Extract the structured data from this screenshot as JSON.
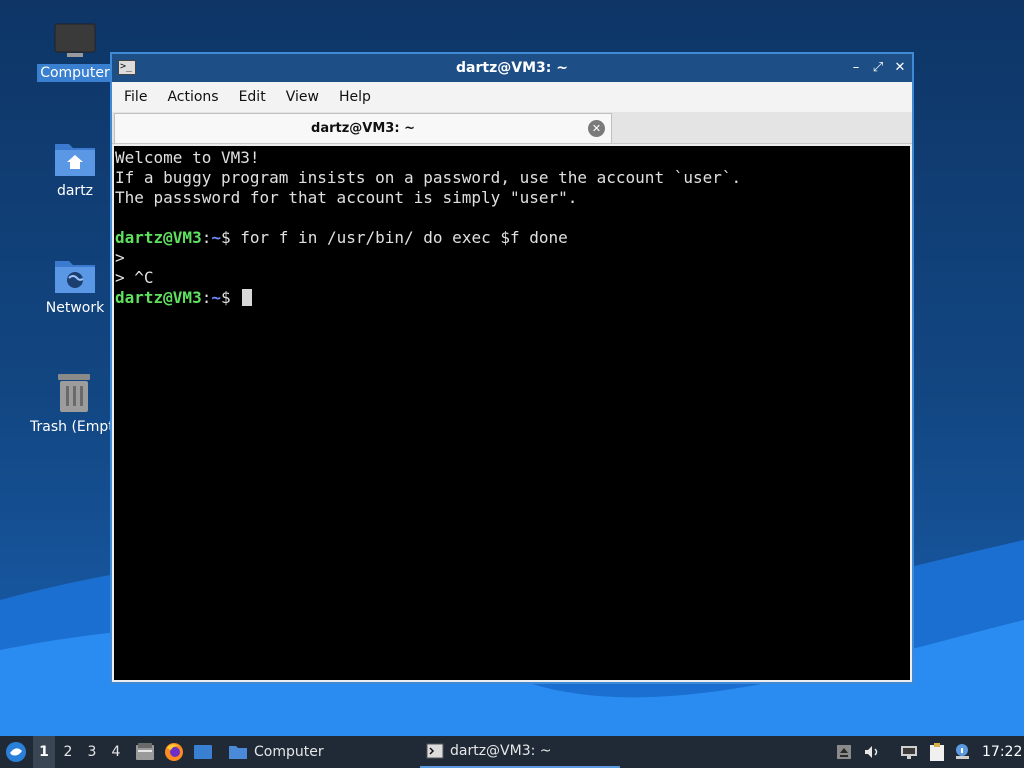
{
  "desktop": {
    "icons": [
      {
        "label": "Computer",
        "icon": "computer-icon"
      },
      {
        "label": "dartz",
        "icon": "home-folder-icon"
      },
      {
        "label": "Network",
        "icon": "network-folder-icon"
      },
      {
        "label": "Trash (Empty)",
        "icon": "trash-icon"
      }
    ]
  },
  "window": {
    "title": "dartz@VM3: ~",
    "menu": [
      "File",
      "Actions",
      "Edit",
      "View",
      "Help"
    ],
    "tab_label": "dartz@VM3: ~"
  },
  "terminal": {
    "lines": [
      "Welcome to VM3!",
      "If a buggy program insists on a password, use the account `user`.",
      "The passsword for that account is simply \"user\"."
    ],
    "prompt_user": "dartz@VM3",
    "prompt_sep": ":",
    "prompt_path": "~",
    "prompt_dollar": "$",
    "command1": " for f in /usr/bin/ do exec $f done",
    "cont1": ">",
    "cont2": "> ^C",
    "command2": " "
  },
  "taskbar": {
    "workspaces": [
      "1",
      "2",
      "3",
      "4"
    ],
    "tasks": [
      {
        "label": "Computer",
        "icon": "folder-icon"
      },
      {
        "label": "dartz@VM3: ~",
        "icon": "terminal-icon"
      }
    ],
    "clock": "17:22"
  },
  "colors": {
    "window_border": "#3f8ad6",
    "titlebar": "#1d4f86",
    "prompt_user": "#5fe05f",
    "prompt_path": "#6f8cff",
    "taskbar": "#1f2a36"
  }
}
